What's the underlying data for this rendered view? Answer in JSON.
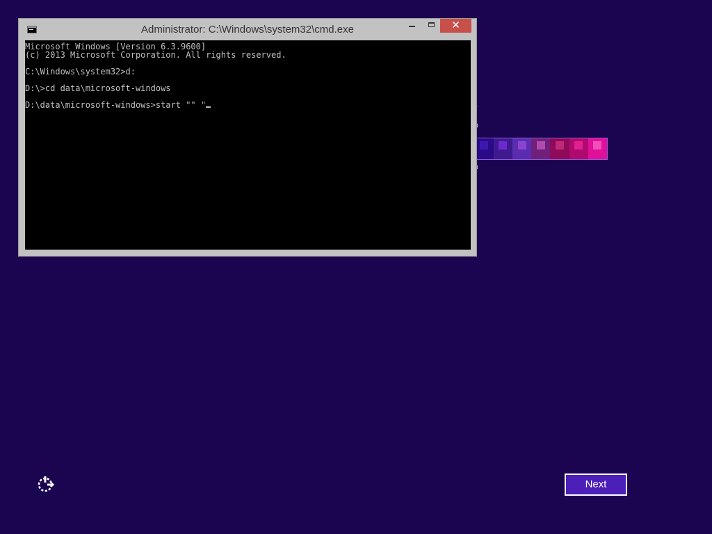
{
  "desktop": {
    "background_color": "#1c0550",
    "swatches": [
      {
        "color": "#1c0550",
        "chip": "#1c0550"
      },
      {
        "color": "#1c0550",
        "chip": "#1c0550"
      },
      {
        "color": "#1c0550",
        "chip": "#2d0d84"
      },
      {
        "color": "#2a0a86",
        "chip": "#3d18b0"
      },
      {
        "color": "#3f1a8e",
        "chip": "#6d2ad0"
      },
      {
        "color": "#5a2cb0",
        "chip": "#8a44d0"
      },
      {
        "color": "#70207a",
        "chip": "#b04aae"
      },
      {
        "color": "#900a5a",
        "chip": "#c02878"
      },
      {
        "color": "#b00a6e",
        "chip": "#e0208e"
      },
      {
        "color": "#e0109a",
        "chip": "#f050b8"
      }
    ],
    "text_fragment_1": ".",
    "text_fragment_2": "0",
    "text_fragment_3": "0"
  },
  "cmd_window": {
    "title": "Administrator: C:\\Windows\\system32\\cmd.exe",
    "icon": "console-icon",
    "close_label": "✕",
    "lines": [
      "Microsoft Windows [Version 6.3.9600]",
      "(c) 2013 Microsoft Corporation. All rights reserved.",
      "",
      "C:\\Windows\\system32>d:",
      "",
      "D:\\>cd data\\microsoft-windows",
      "",
      "D:\\data\\microsoft-windows>start \"\" \""
    ]
  },
  "footer": {
    "ease_of_access_icon": "ease-of-access-icon",
    "next_label": "Next"
  }
}
